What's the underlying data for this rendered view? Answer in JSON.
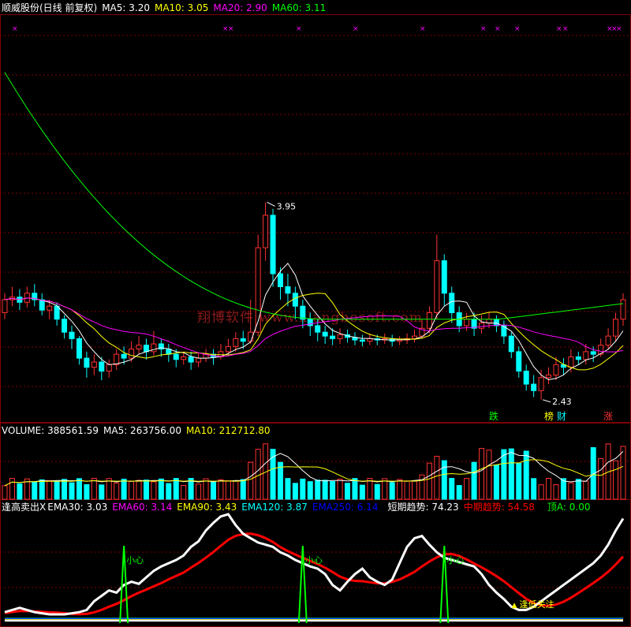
{
  "price_panel": {
    "title": "顺威股份(日线 前复权)",
    "ma5": {
      "label": "MA5: 3.20",
      "color": "#ffffff"
    },
    "ma10": {
      "label": "MA10: 3.05",
      "color": "#ffff00"
    },
    "ma20": {
      "label": "MA20: 2.90",
      "color": "#ff00ff"
    },
    "ma60": {
      "label": "MA60: 3.11",
      "color": "#00ff00"
    },
    "high_label": "3.95",
    "low_label": "2.43",
    "signals": [
      "跌",
      "榜",
      "财",
      "涨"
    ]
  },
  "volume_panel": {
    "volume": {
      "label": "VOLUME: 388561.59",
      "color": "#ffffff"
    },
    "ma5": {
      "label": "MA5: 263756.00",
      "color": "#ffffff"
    },
    "ma10": {
      "label": "MA10: 212712.80",
      "color": "#ffff00"
    }
  },
  "indicator_panel": {
    "name": {
      "label": "逢高卖出X",
      "color": "#ffffff"
    },
    "ema30": {
      "label": "EMA30: 3.03",
      "color": "#ffffff"
    },
    "ema60": {
      "label": "EMA60: 3.14",
      "color": "#ff00ff"
    },
    "ema90": {
      "label": "EMA90: 3.43",
      "color": "#ffff00"
    },
    "ema120": {
      "label": "EMA120: 3.87",
      "color": "#00ffff"
    },
    "ema250": {
      "label": "EMA250: 6.14",
      "color": "#0000ff"
    },
    "short": {
      "label": "短期趋势: 74.23",
      "color": "#ffffff"
    },
    "mid": {
      "label": "中期趋势: 54.58",
      "color": "#ff0000"
    },
    "top": {
      "label": "顶A: 0.00",
      "color": "#00ff00"
    },
    "caution_label": "小心",
    "focus_label": "逢低关注"
  },
  "watermark": "翔博软件 www.xiangbosoft.com",
  "colors": {
    "up": "#ff3232",
    "down": "#00ffff",
    "grid": "#800000"
  },
  "chart_data": {
    "type": "candlestick",
    "price_range_approx": [
      2.43,
      3.95
    ],
    "candles": [
      [
        3.1,
        3.2,
        3.25,
        3.05
      ],
      [
        3.2,
        3.22,
        3.3,
        3.15
      ],
      [
        3.22,
        3.18,
        3.28,
        3.12
      ],
      [
        3.18,
        3.25,
        3.3,
        3.14
      ],
      [
        3.25,
        3.2,
        3.32,
        3.15
      ],
      [
        3.2,
        3.12,
        3.25,
        3.08
      ],
      [
        3.12,
        3.15,
        3.2,
        3.05
      ],
      [
        3.15,
        3.05,
        3.18,
        3.0
      ],
      [
        3.05,
        2.95,
        3.08,
        2.9
      ],
      [
        2.95,
        2.9,
        3.0,
        2.82
      ],
      [
        2.9,
        2.75,
        2.92,
        2.7
      ],
      [
        2.75,
        2.68,
        2.8,
        2.6
      ],
      [
        2.68,
        2.72,
        2.78,
        2.62
      ],
      [
        2.72,
        2.65,
        2.76,
        2.58
      ],
      [
        2.65,
        2.7,
        2.74,
        2.6
      ],
      [
        2.7,
        2.78,
        2.82,
        2.66
      ],
      [
        2.78,
        2.75,
        2.84,
        2.7
      ],
      [
        2.75,
        2.82,
        2.88,
        2.72
      ],
      [
        2.82,
        2.85,
        2.92,
        2.78
      ],
      [
        2.85,
        2.8,
        2.9,
        2.74
      ],
      [
        2.8,
        2.86,
        2.96,
        2.77
      ],
      [
        2.86,
        2.82,
        2.9,
        2.76
      ],
      [
        2.82,
        2.78,
        2.86,
        2.72
      ],
      [
        2.78,
        2.74,
        2.82,
        2.68
      ],
      [
        2.74,
        2.76,
        2.8,
        2.7
      ],
      [
        2.76,
        2.72,
        2.8,
        2.66
      ],
      [
        2.72,
        2.75,
        2.79,
        2.68
      ],
      [
        2.75,
        2.78,
        2.82,
        2.72
      ],
      [
        2.78,
        2.76,
        2.82,
        2.7
      ],
      [
        2.76,
        2.8,
        2.86,
        2.74
      ],
      [
        2.8,
        2.84,
        2.9,
        2.78
      ],
      [
        2.84,
        2.9,
        2.95,
        2.8
      ],
      [
        2.9,
        2.88,
        2.96,
        2.82
      ],
      [
        2.88,
        2.95,
        3.2,
        2.86
      ],
      [
        2.95,
        3.6,
        3.7,
        2.92
      ],
      [
        3.6,
        3.85,
        3.95,
        3.5
      ],
      [
        3.85,
        3.4,
        3.9,
        3.3
      ],
      [
        3.4,
        3.3,
        3.45,
        3.2
      ],
      [
        3.3,
        3.25,
        3.4,
        3.15
      ],
      [
        3.25,
        3.15,
        3.3,
        3.05
      ],
      [
        3.15,
        3.05,
        3.2,
        2.98
      ],
      [
        3.05,
        3.0,
        3.1,
        2.92
      ],
      [
        3.0,
        2.95,
        3.05,
        2.88
      ],
      [
        2.95,
        2.92,
        3.0,
        2.86
      ],
      [
        2.92,
        2.9,
        2.98,
        2.85
      ],
      [
        2.9,
        2.93,
        2.98,
        2.86
      ],
      [
        2.93,
        2.91,
        2.97,
        2.87
      ],
      [
        2.91,
        2.89,
        2.95,
        2.85
      ],
      [
        2.89,
        2.88,
        2.93,
        2.84
      ],
      [
        2.88,
        2.9,
        2.94,
        2.85
      ],
      [
        2.9,
        2.89,
        2.93,
        2.85
      ],
      [
        2.89,
        2.9,
        2.94,
        2.86
      ],
      [
        2.9,
        2.88,
        2.93,
        2.84
      ],
      [
        2.88,
        2.89,
        2.92,
        2.85
      ],
      [
        2.89,
        2.9,
        2.94,
        2.86
      ],
      [
        2.9,
        2.92,
        2.97,
        2.87
      ],
      [
        2.92,
        2.98,
        3.05,
        2.9
      ],
      [
        2.98,
        3.1,
        3.15,
        2.94
      ],
      [
        3.1,
        3.5,
        3.7,
        3.05
      ],
      [
        3.5,
        3.25,
        3.55,
        3.15
      ],
      [
        3.25,
        3.1,
        3.3,
        3.02
      ],
      [
        3.1,
        3.0,
        3.15,
        2.95
      ],
      [
        3.0,
        3.05,
        3.1,
        2.96
      ],
      [
        3.05,
        2.98,
        3.1,
        2.92
      ],
      [
        2.98,
        3.02,
        3.08,
        2.94
      ],
      [
        3.02,
        3.05,
        3.1,
        2.98
      ],
      [
        3.05,
        3.0,
        3.08,
        2.95
      ],
      [
        3.0,
        2.92,
        3.04,
        2.86
      ],
      [
        2.92,
        2.8,
        2.95,
        2.75
      ],
      [
        2.8,
        2.65,
        2.84,
        2.6
      ],
      [
        2.65,
        2.55,
        2.7,
        2.5
      ],
      [
        2.55,
        2.5,
        2.62,
        2.45
      ],
      [
        2.5,
        2.6,
        2.66,
        2.43
      ],
      [
        2.6,
        2.62,
        2.68,
        2.55
      ],
      [
        2.62,
        2.7,
        2.76,
        2.58
      ],
      [
        2.7,
        2.68,
        2.75,
        2.62
      ],
      [
        2.68,
        2.76,
        2.82,
        2.64
      ],
      [
        2.76,
        2.74,
        2.8,
        2.7
      ],
      [
        2.74,
        2.8,
        2.86,
        2.7
      ],
      [
        2.8,
        2.78,
        2.84,
        2.72
      ],
      [
        2.78,
        2.85,
        2.9,
        2.76
      ],
      [
        2.85,
        2.92,
        2.98,
        2.82
      ],
      [
        2.92,
        3.05,
        3.1,
        2.88
      ],
      [
        3.05,
        3.2,
        3.25,
        3.0
      ]
    ]
  }
}
